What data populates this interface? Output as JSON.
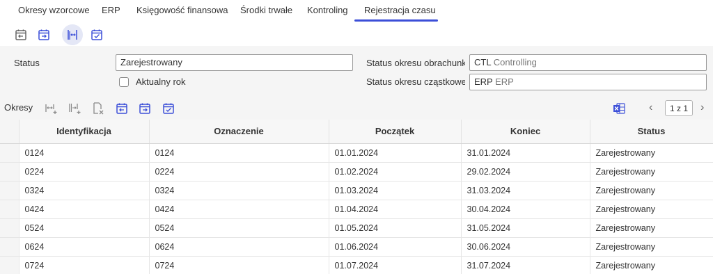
{
  "tabs": [
    {
      "label": "Okresy wzorcowe"
    },
    {
      "label": "ERP"
    },
    {
      "label": "Księgowość finansowa"
    },
    {
      "label": "Środki trwałe"
    },
    {
      "label": "Kontroling"
    },
    {
      "label": "Rejestracja czasu"
    }
  ],
  "active_tab": "Rejestracja czasu",
  "accent_color": "#3c4fd8",
  "toolbar": {
    "icons": [
      "calendar-prev-icon",
      "calendar-next-icon",
      "split-columns-icon",
      "calendar-check-icon"
    ]
  },
  "form": {
    "status_label": "Status",
    "status_value": "Zarejestrowany",
    "aktualny_rok_label": "Aktualny rok",
    "status_okresu_obr_label": "Status okresu obrachunk...",
    "status_okresu_obr_code": "CTL",
    "status_okresu_obr_text": "Controlling",
    "status_okresu_czast_label": "Status okresu cząstkowe...",
    "status_okresu_czast_code": "ERP",
    "status_okresu_czast_text": "ERP"
  },
  "table_toolbar": {
    "title": "Okresy",
    "pager": "1 z 1",
    "icons": [
      "split-add-icon",
      "merge-add-icon",
      "document-delete-icon",
      "calendar-prev-icon",
      "calendar-next-icon",
      "calendar-check-icon",
      "excel-export-icon"
    ]
  },
  "table": {
    "columns": [
      "Identyfikacja",
      "Oznaczenie",
      "Początek",
      "Koniec",
      "Status"
    ],
    "rows": [
      [
        "0124",
        "0124",
        "01.01.2024",
        "31.01.2024",
        "Zarejestrowany"
      ],
      [
        "0224",
        "0224",
        "01.02.2024",
        "29.02.2024",
        "Zarejestrowany"
      ],
      [
        "0324",
        "0324",
        "01.03.2024",
        "31.03.2024",
        "Zarejestrowany"
      ],
      [
        "0424",
        "0424",
        "01.04.2024",
        "30.04.2024",
        "Zarejestrowany"
      ],
      [
        "0524",
        "0524",
        "01.05.2024",
        "31.05.2024",
        "Zarejestrowany"
      ],
      [
        "0624",
        "0624",
        "01.06.2024",
        "30.06.2024",
        "Zarejestrowany"
      ],
      [
        "0724",
        "0724",
        "01.07.2024",
        "31.07.2024",
        "Zarejestrowany"
      ]
    ]
  }
}
